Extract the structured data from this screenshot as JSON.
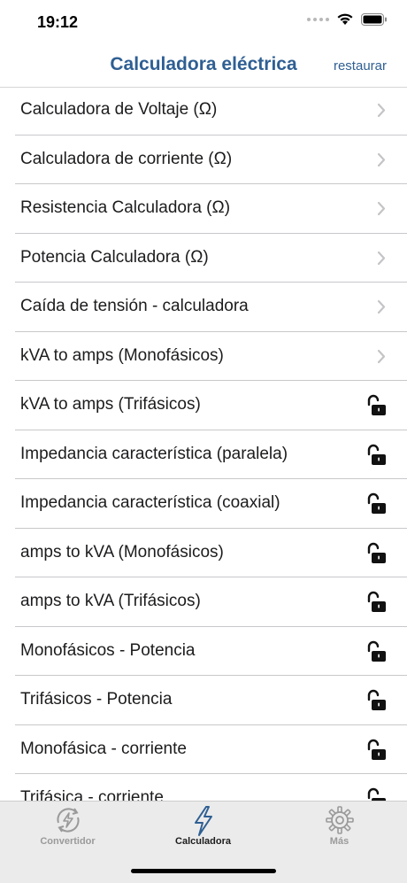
{
  "status": {
    "time": "19:12"
  },
  "nav": {
    "title": "Calculadora eléctrica",
    "restore_label": "restaurar"
  },
  "list": {
    "items": [
      {
        "label": "Calculadora de Voltaje (Ω)",
        "accessory": "chevron"
      },
      {
        "label": "Calculadora de corriente (Ω)",
        "accessory": "chevron"
      },
      {
        "label": "Resistencia Calculadora (Ω)",
        "accessory": "chevron"
      },
      {
        "label": "Potencia Calculadora (Ω)",
        "accessory": "chevron"
      },
      {
        "label": "Caída de tensión - calculadora",
        "accessory": "chevron"
      },
      {
        "label": "kVA to amps (Monofásicos)",
        "accessory": "chevron"
      },
      {
        "label": "kVA to amps (Trifásicos)",
        "accessory": "lock-icon"
      },
      {
        "label": "Impedancia característica (paralela)",
        "accessory": "lock-icon"
      },
      {
        "label": "Impedancia característica (coaxial)",
        "accessory": "lock-icon"
      },
      {
        "label": "amps to kVA (Monofásicos)",
        "accessory": "lock-icon"
      },
      {
        "label": "amps to kVA (Trifásicos)",
        "accessory": "lock-icon"
      },
      {
        "label": "Monofásicos - Potencia",
        "accessory": "lock-icon"
      },
      {
        "label": "Trifásicos - Potencia",
        "accessory": "lock-icon"
      },
      {
        "label": "Monofásica - corriente",
        "accessory": "lock-icon"
      },
      {
        "label": "Trifásica - corriente",
        "accessory": "lock-icon"
      }
    ]
  },
  "tabs": [
    {
      "label": "Convertidor",
      "icon": "converter-icon",
      "active": false
    },
    {
      "label": "Calculadora",
      "icon": "lightning-icon",
      "active": true
    },
    {
      "label": "Más",
      "icon": "gear-icon",
      "active": false
    }
  ],
  "colors": {
    "accent": "#2f5f93",
    "active_tab_label": "#1c1c1e",
    "inactive_tab": "#9a9a9a",
    "separator": "#c8c8cc",
    "chevron": "#c4c4c7"
  }
}
